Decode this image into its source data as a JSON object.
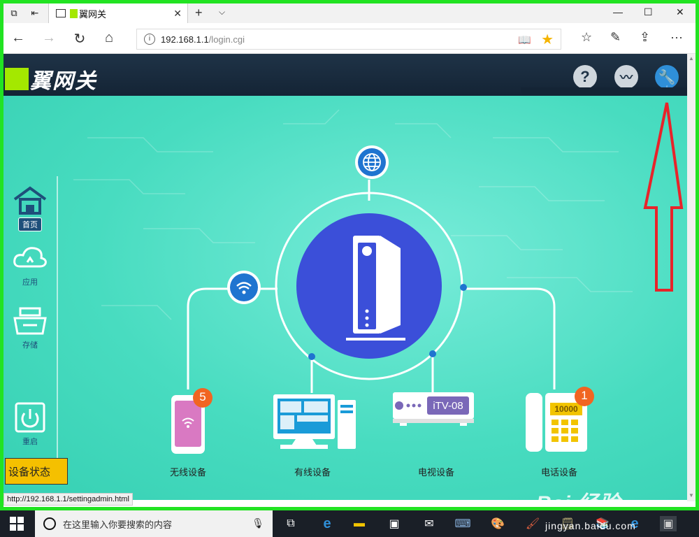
{
  "browser": {
    "tab_title": "翼网关",
    "url_host": "192.168.1.1",
    "url_path": "/login.cgi",
    "status_url": "http://192.168.1.1/settingadmin.html"
  },
  "header": {
    "logo_text": "翼网关"
  },
  "sidebar": {
    "items": [
      {
        "label": "首页"
      },
      {
        "label": "应用"
      },
      {
        "label": "存储"
      },
      {
        "label": "重启"
      }
    ],
    "status_button": "设备状态"
  },
  "devices": {
    "wireless": {
      "label": "无线设备",
      "badge": "5"
    },
    "wired": {
      "label": "有线设备"
    },
    "tv": {
      "label": "电视设备",
      "name": "iTV-08"
    },
    "phone": {
      "label": "电话设备",
      "badge": "1",
      "number": "10000"
    }
  },
  "taskbar": {
    "search_placeholder": "在这里输入你要搜索的内容"
  },
  "watermark": {
    "brand": "Bai 经验",
    "url": "jingyan.baidu.com"
  },
  "colors": {
    "frame": "#22e322",
    "logo_accent": "#a4e800",
    "router_circle": "#3b4fd9",
    "annotation_arrow": "#e8232a",
    "status_button": "#f5c000"
  }
}
